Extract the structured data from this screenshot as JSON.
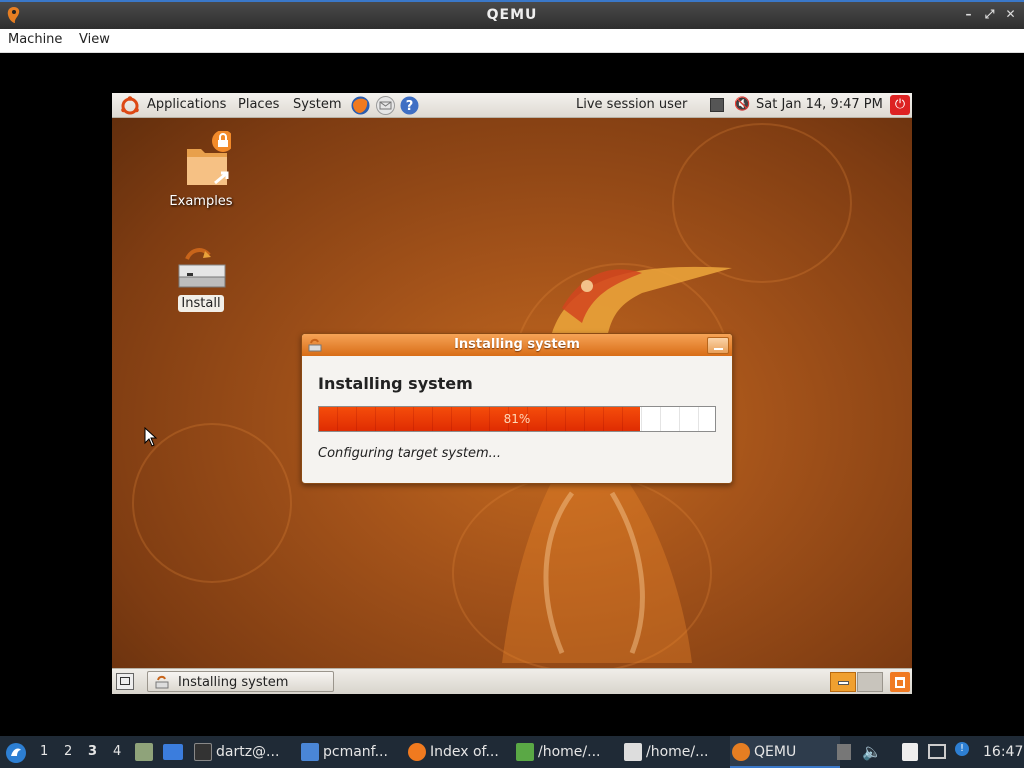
{
  "qemu": {
    "title": "QEMU",
    "menu": [
      "Machine",
      "View"
    ]
  },
  "guest": {
    "top_panel": {
      "menus": [
        "Applications",
        "Places",
        "System"
      ],
      "user": "Live session user",
      "clock": "Sat Jan 14,  9:47 PM"
    },
    "desktop_icons": [
      "Examples",
      "Install"
    ],
    "dialog": {
      "title": "Installing system",
      "heading": "Installing system",
      "progress_percent": 81,
      "progress_label": "81%",
      "status": "Configuring target system..."
    },
    "bottom_panel": {
      "task": "Installing system"
    }
  },
  "host_taskbar": {
    "workspaces": [
      "1",
      "2",
      "3",
      "4"
    ],
    "active_workspace": "3",
    "tasks": [
      "dartz@...",
      "pcmanf...",
      "Index of...",
      "/home/...",
      "/home/...",
      "QEMU"
    ],
    "clock": "16:47"
  },
  "colors": {
    "accent_orange": "#e0701e",
    "host_taskbar_bg": "#1f2a36"
  }
}
